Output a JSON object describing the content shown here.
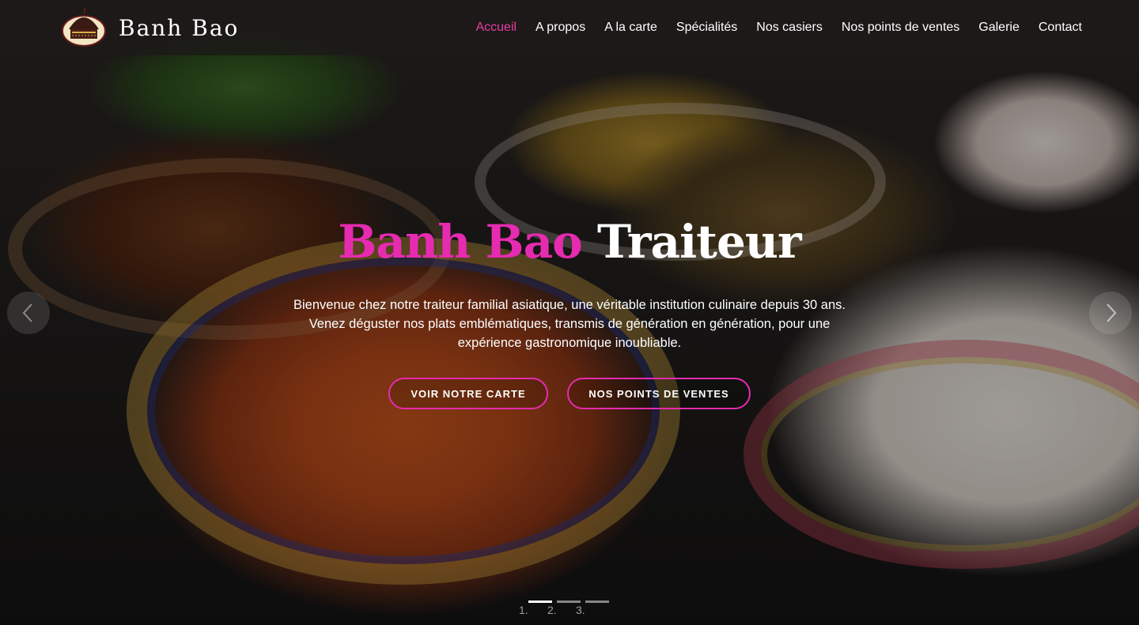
{
  "brand": {
    "name": "Banh Bao",
    "logo_icon": "banh-bao-logo-icon"
  },
  "nav": {
    "items": [
      {
        "label": "Accueil",
        "active": true
      },
      {
        "label": "A propos",
        "active": false
      },
      {
        "label": "A la carte",
        "active": false
      },
      {
        "label": "Spécialités",
        "active": false
      },
      {
        "label": "Nos casiers",
        "active": false
      },
      {
        "label": "Nos points de ventes",
        "active": false
      },
      {
        "label": "Galerie",
        "active": false
      },
      {
        "label": "Contact",
        "active": false
      }
    ]
  },
  "hero": {
    "title_pink": "Banh Bao",
    "title_white": "Traiteur",
    "description": "Bienvenue chez notre traiteur familial asiatique, une véritable institution culinaire depuis 30 ans. Venez déguster nos plats emblématiques, transmis de génération en génération, pour une expérience gastronomique inoubliable.",
    "button_primary": "VOIR NOTRE CARTE",
    "button_secondary": "NOS POINTS DE VENTES"
  },
  "carousel": {
    "prev_icon": "chevron-left-icon",
    "next_icon": "chevron-right-icon",
    "indicators": [
      "1.",
      "2.",
      "3."
    ],
    "active_index": 0
  },
  "colors": {
    "accent": "#e62bb0",
    "nav_active": "#e83ea2",
    "header_bg": "#1c1a19"
  }
}
